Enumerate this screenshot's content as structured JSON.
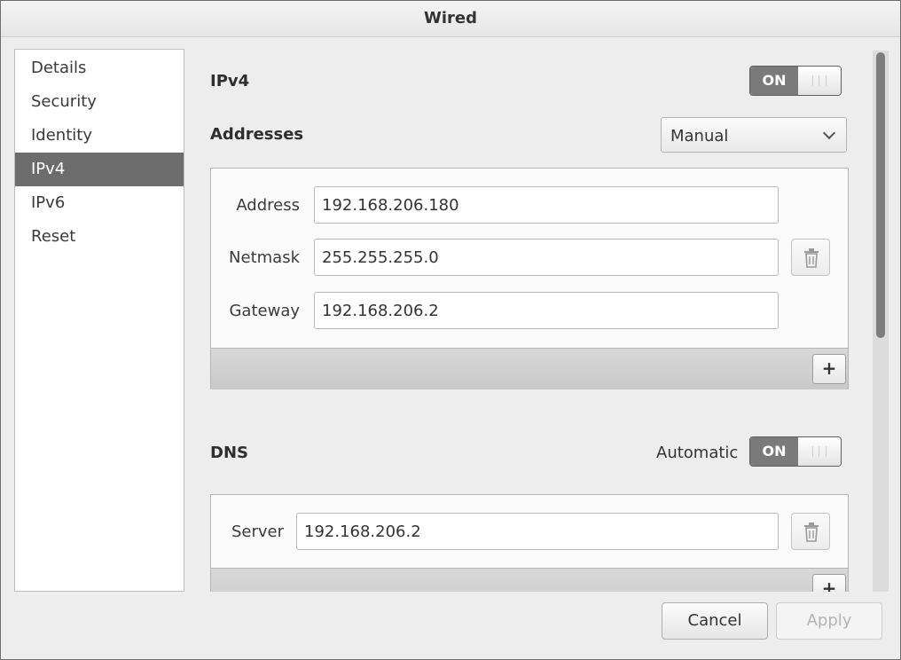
{
  "window": {
    "title": "Wired"
  },
  "sidebar": {
    "items": [
      {
        "label": "Details"
      },
      {
        "label": "Security"
      },
      {
        "label": "Identity"
      },
      {
        "label": "IPv4",
        "selected": true
      },
      {
        "label": "IPv6"
      },
      {
        "label": "Reset"
      }
    ]
  },
  "ipv4": {
    "heading": "IPv4",
    "switch": {
      "label": "ON",
      "state": "on"
    },
    "addresses": {
      "heading": "Addresses",
      "method": "Manual",
      "address_label": "Address",
      "address_value": "192.168.206.180",
      "netmask_label": "Netmask",
      "netmask_value": "255.255.255.0",
      "gateway_label": "Gateway",
      "gateway_value": "192.168.206.2",
      "add_label": "+"
    }
  },
  "dns": {
    "heading": "DNS",
    "automatic_label": "Automatic",
    "switch": {
      "label": "ON",
      "state": "on"
    },
    "server_label": "Server",
    "server_value": "192.168.206.2",
    "add_label": "+"
  },
  "footer": {
    "cancel_label": "Cancel",
    "apply_label": "Apply",
    "apply_enabled": false
  },
  "icons": {
    "trash": "trash-icon",
    "plus": "plus-icon",
    "dropdown": "chevron-down-icon",
    "switch_grip": "grip-icon"
  },
  "colors": {
    "selected_bg": "#6c6c6c",
    "switch_on": "#7a7a7a",
    "window_bg": "#ededed"
  }
}
